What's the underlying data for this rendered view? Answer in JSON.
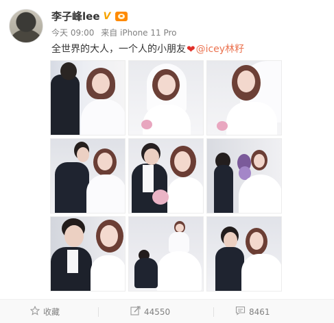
{
  "user": {
    "name": "李子峰lee",
    "verified_icon": "verified-v-icon",
    "vip_icon": "vip-crown-icon"
  },
  "meta": {
    "time": "今天 09:00",
    "source": "来自 iPhone 11 Pro"
  },
  "post": {
    "text_main": "全世界的大人，一个人的小朋友",
    "emoji_icon": "red-heart-icon",
    "mention": "@icey林籽"
  },
  "photos": [
    "photo-1",
    "photo-2",
    "photo-3",
    "photo-4",
    "photo-5",
    "photo-6",
    "photo-7",
    "photo-8",
    "photo-9"
  ],
  "actions": {
    "favorite_label": "收藏",
    "repost_count": "44550",
    "comment_count": "8461"
  },
  "colors": {
    "mention": "#eb7350",
    "verified": "#f7a400",
    "vip": "#ff8a00",
    "meta": "#808080"
  }
}
